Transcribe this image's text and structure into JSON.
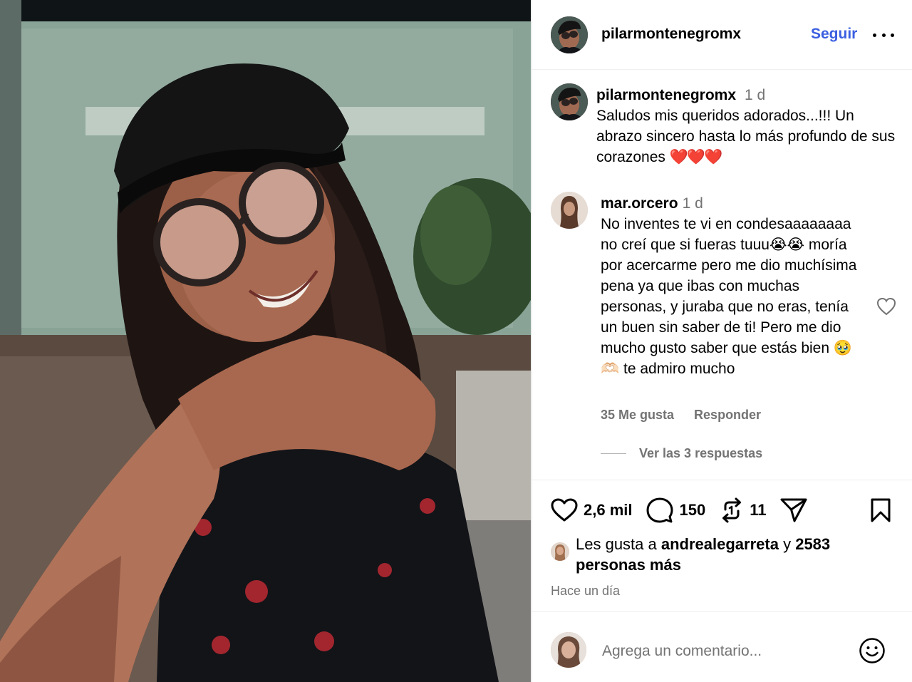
{
  "post": {
    "author": "pilarmontenegromx",
    "follow_label": "Seguir"
  },
  "caption": {
    "username": "pilarmontenegromx",
    "time": "1 d",
    "text": "Saludos mis queridos adorados...!!! Un abrazo sincero hasta lo más profundo de sus corazones ",
    "hearts": "❤️❤️❤️"
  },
  "comment": {
    "username": "mar.orcero",
    "time": "1 d",
    "text": "No inventes te vi en condesaaaaaaaa no creí que si fueras tuuu😭😭 moría por acercarme pero me dio muchísima pena ya que ibas con muchas personas, y juraba que no eras, tenía un buen sin saber de ti! Pero me dio mucho gusto saber que estás bien 🥹🫶🏻 te admiro mucho",
    "likes_label": "35 Me gusta",
    "reply_label": "Responder",
    "view_replies": "Ver las 3 respuestas"
  },
  "actions": {
    "likes_count": "2,6 mil",
    "comments_count": "150",
    "reposts_count": "11"
  },
  "liked_by": {
    "prefix": "Les gusta a ",
    "user": "andrealegarreta",
    "conj": " y ",
    "others": "2583 personas más"
  },
  "timestamp": "Hace un día",
  "add_comment": {
    "placeholder": "Agrega un comentario..."
  },
  "icons": {
    "like": "heart-icon",
    "comment": "comment-bubble-icon",
    "repost": "repost-icon",
    "share": "send-icon",
    "save": "bookmark-icon",
    "emoji": "smiley-icon",
    "more": "more-dots-icon"
  }
}
